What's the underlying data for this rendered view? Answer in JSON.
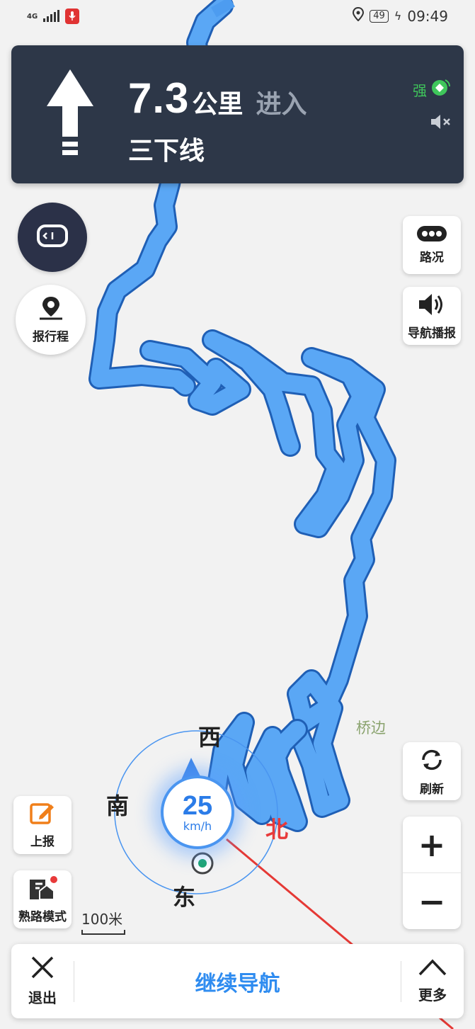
{
  "status_bar": {
    "network": "4G",
    "battery": "49",
    "time": "09:49"
  },
  "nav_panel": {
    "distance_value": "7.3",
    "distance_unit": "公里",
    "action": "进入",
    "road_name": "三下线",
    "gps_signal": "强"
  },
  "buttons": {
    "report_trip": "报行程",
    "traffic": "路况",
    "voice_broadcast": "导航播报",
    "refresh": "刷新",
    "report": "上报",
    "familiar_mode": "熟路模式",
    "zoom_in": "+",
    "zoom_out": "−"
  },
  "map": {
    "place_label": "桥边",
    "scale_label": "100米",
    "compass": {
      "west": "西",
      "south": "南",
      "north": "北",
      "east": "东"
    },
    "speed": {
      "value": "25",
      "unit": "km/h"
    },
    "route_color": "#4d9cf0"
  },
  "bottom_bar": {
    "exit": "退出",
    "continue": "继续导航",
    "more": "更多"
  }
}
